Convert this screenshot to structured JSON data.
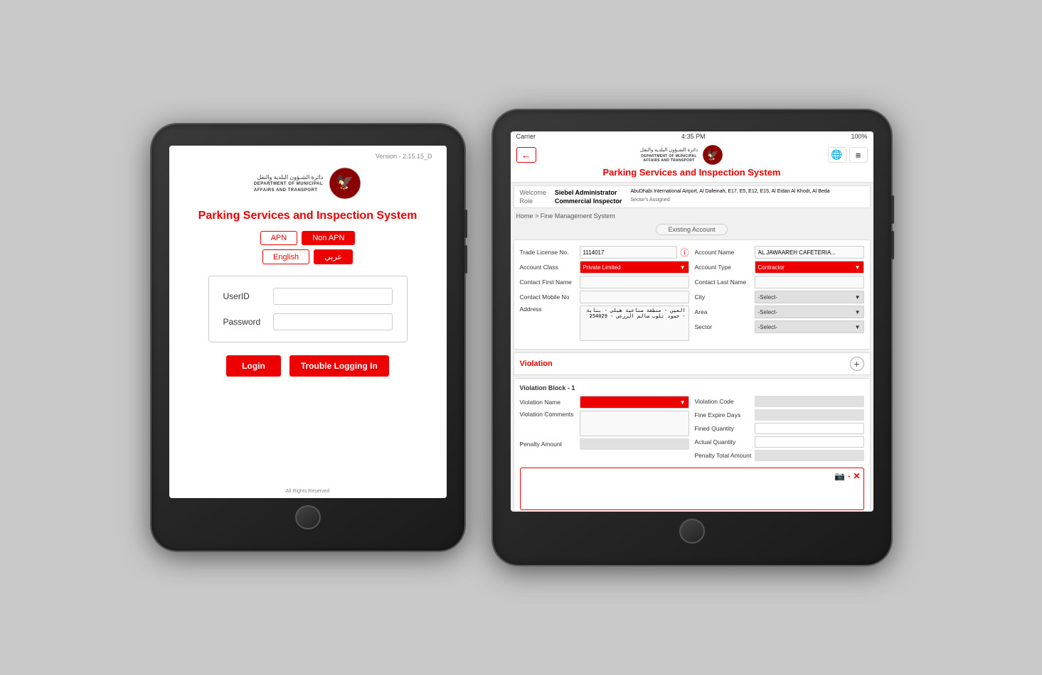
{
  "left_ipad": {
    "version": "Version - 2.15.15_D",
    "dept_arabic": "دائرة الشـؤون البلدية والنقل",
    "dept_line1": "DEPARTMENT OF MUNICIPAL",
    "dept_line2": "AFFAIRS AND TRANSPORT",
    "app_title": "Parking Services and Inspection System",
    "btn_apn": "APN",
    "btn_non_apn": "Non APN",
    "btn_english": "English",
    "btn_arabic": "عربي",
    "userid_label": "UserID",
    "password_label": "Password",
    "userid_placeholder": "",
    "password_placeholder": "",
    "btn_login": "Login",
    "btn_trouble": "Trouble Logging In",
    "footer": "All Rights Reserved"
  },
  "right_ipad": {
    "status_bar": {
      "carrier": "Carrier",
      "time": "4:35 PM",
      "battery": "100%"
    },
    "dept_arabic": "دائرة الشـؤون البلدية والنقل",
    "dept_line1": "DEPARTMENT OF MUNICIPAL",
    "dept_line2": "AFFAIRS AND TRANSPORT",
    "app_title": "Parking Services and Inspection System",
    "welcome": {
      "welcome_label": "Welcome",
      "welcome_value": "Siebel Administrator",
      "role_label": "Role",
      "role_value": "Commercial Inspector",
      "sector_label": "Sector's Assigned",
      "sector_value": "AbuDhabi International Airport, Al Dafeinah, E17, E5, E12, E15, Al Eidan Al Khodr, Al Beda"
    },
    "breadcrumb": "Home > Fine Management System",
    "existing_account": "Existing Account",
    "fields": {
      "trade_license_no_label": "Trade License No.",
      "trade_license_no_value": "1114017",
      "account_name_label": "Account Name",
      "account_name_value": "AL JAWAAREH CAFETERIA...",
      "account_class_label": "Account Class",
      "account_class_value": "Private Limited",
      "account_type_label": "Account Type",
      "account_type_value": "Contractor",
      "contact_first_name_label": "Contact First Name",
      "contact_first_name_value": "",
      "contact_last_name_label": "Contact Last Name",
      "contact_last_name_value": "",
      "contact_mobile_label": "Contact Mobile No",
      "contact_mobile_value": "",
      "city_label": "City",
      "city_value": "-Select-",
      "address_label": "Address",
      "address_value": "العين - منطقة صناعية هيلي - بناية - حمود تلوب سالم الرزعي - 254029",
      "area_label": "Area",
      "area_value": "-Select-",
      "sector_label": "Sector",
      "sector_value": "-Select-"
    },
    "violation": {
      "title": "Violation",
      "block_title": "Violation Block - 1",
      "violation_name_label": "Violation Name",
      "violation_code_label": "Violation Code",
      "violation_comments_label": "Violation Comments",
      "fine_expire_days_label": "Fine Expire Days",
      "fined_quantity_label": "Fined Quantity",
      "actual_quantity_label": "Actual Quantity",
      "penalty_amount_label": "Penalty Amount",
      "penalty_total_label": "Penalty Total Amount"
    }
  }
}
